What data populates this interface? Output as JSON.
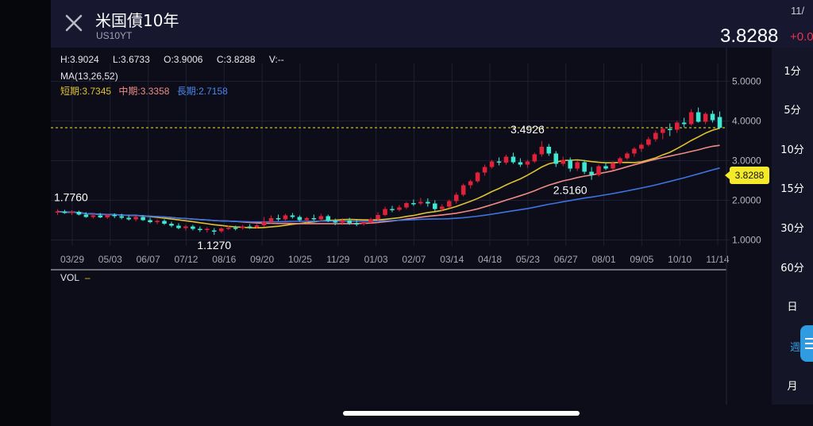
{
  "header": {
    "title": "米国債10年",
    "symbol": "US10YT",
    "date_clipped": "11/",
    "price": "3.8288",
    "change_clipped": "+0.0"
  },
  "ohlc": {
    "high": "H:3.9024",
    "low": "L:3.6733",
    "open": "O:3.9006",
    "close": "C:3.8288",
    "volume": "V:--"
  },
  "ma": {
    "title": "MA(13,26,52)",
    "short": "短期:3.7345",
    "mid": "中期:3.3358",
    "long": "長期:2.7158"
  },
  "volume_label": "VOL",
  "current_price_tag": "3.8288",
  "colors": {
    "up": "#e0213a",
    "down": "#3ee8d2",
    "ma_short": "#e0c230",
    "ma_mid": "#f08a86",
    "ma_long": "#3d74e0",
    "price_line": "#f5ea2a"
  },
  "timeframes": [
    "1分",
    "5分",
    "10分",
    "15分",
    "30分",
    "60分",
    "日",
    "週",
    "月"
  ],
  "active_timeframe": "週",
  "chart_data": {
    "type": "candlestick",
    "x_ticks": [
      "03/29",
      "05/03",
      "06/07",
      "07/12",
      "08/16",
      "09/20",
      "10/25",
      "11/29",
      "01/03",
      "02/07",
      "03/14",
      "04/18",
      "05/23",
      "06/27",
      "08/01",
      "09/05",
      "10/10",
      "11/14"
    ],
    "y_ticks": [
      "5.0000",
      "4.0000",
      "3.0000",
      "2.0000",
      "1.0000"
    ],
    "ylim": [
      0.85,
      5.25
    ],
    "last_close": 3.8288,
    "annotations": [
      {
        "label": "1.7760",
        "value": 1.776,
        "index": 0
      },
      {
        "label": "1.1270",
        "value": 1.127,
        "index": 22
      },
      {
        "label": "3.4926",
        "value": 3.4926,
        "index": 66
      },
      {
        "label": "2.5160",
        "value": 2.516,
        "index": 72
      }
    ],
    "candles": [
      {
        "o": 1.69,
        "h": 1.776,
        "l": 1.63,
        "c": 1.72
      },
      {
        "o": 1.72,
        "h": 1.76,
        "l": 1.66,
        "c": 1.68
      },
      {
        "o": 1.68,
        "h": 1.75,
        "l": 1.63,
        "c": 1.71
      },
      {
        "o": 1.71,
        "h": 1.74,
        "l": 1.62,
        "c": 1.64
      },
      {
        "o": 1.64,
        "h": 1.7,
        "l": 1.56,
        "c": 1.58
      },
      {
        "o": 1.58,
        "h": 1.66,
        "l": 1.54,
        "c": 1.62
      },
      {
        "o": 1.62,
        "h": 1.68,
        "l": 1.55,
        "c": 1.57
      },
      {
        "o": 1.57,
        "h": 1.66,
        "l": 1.53,
        "c": 1.63
      },
      {
        "o": 1.63,
        "h": 1.67,
        "l": 1.55,
        "c": 1.6
      },
      {
        "o": 1.6,
        "h": 1.66,
        "l": 1.52,
        "c": 1.56
      },
      {
        "o": 1.56,
        "h": 1.62,
        "l": 1.49,
        "c": 1.52
      },
      {
        "o": 1.52,
        "h": 1.6,
        "l": 1.47,
        "c": 1.58
      },
      {
        "o": 1.58,
        "h": 1.62,
        "l": 1.48,
        "c": 1.5
      },
      {
        "o": 1.5,
        "h": 1.56,
        "l": 1.42,
        "c": 1.45
      },
      {
        "o": 1.45,
        "h": 1.52,
        "l": 1.4,
        "c": 1.48
      },
      {
        "o": 1.48,
        "h": 1.52,
        "l": 1.38,
        "c": 1.41
      },
      {
        "o": 1.41,
        "h": 1.46,
        "l": 1.32,
        "c": 1.36
      },
      {
        "o": 1.36,
        "h": 1.42,
        "l": 1.27,
        "c": 1.3
      },
      {
        "o": 1.3,
        "h": 1.38,
        "l": 1.24,
        "c": 1.34
      },
      {
        "o": 1.34,
        "h": 1.38,
        "l": 1.24,
        "c": 1.28
      },
      {
        "o": 1.28,
        "h": 1.34,
        "l": 1.2,
        "c": 1.26
      },
      {
        "o": 1.26,
        "h": 1.32,
        "l": 1.19,
        "c": 1.28
      },
      {
        "o": 1.24,
        "h": 1.3,
        "l": 1.127,
        "c": 1.22
      },
      {
        "o": 1.22,
        "h": 1.32,
        "l": 1.18,
        "c": 1.29
      },
      {
        "o": 1.29,
        "h": 1.36,
        "l": 1.25,
        "c": 1.31
      },
      {
        "o": 1.31,
        "h": 1.36,
        "l": 1.24,
        "c": 1.3
      },
      {
        "o": 1.3,
        "h": 1.38,
        "l": 1.26,
        "c": 1.34
      },
      {
        "o": 1.34,
        "h": 1.4,
        "l": 1.28,
        "c": 1.32
      },
      {
        "o": 1.32,
        "h": 1.4,
        "l": 1.29,
        "c": 1.37
      },
      {
        "o": 1.37,
        "h": 1.58,
        "l": 1.33,
        "c": 1.46
      },
      {
        "o": 1.46,
        "h": 1.62,
        "l": 1.42,
        "c": 1.55
      },
      {
        "o": 1.55,
        "h": 1.64,
        "l": 1.48,
        "c": 1.52
      },
      {
        "o": 1.52,
        "h": 1.66,
        "l": 1.49,
        "c": 1.62
      },
      {
        "o": 1.62,
        "h": 1.68,
        "l": 1.54,
        "c": 1.58
      },
      {
        "o": 1.58,
        "h": 1.62,
        "l": 1.46,
        "c": 1.5
      },
      {
        "o": 1.5,
        "h": 1.58,
        "l": 1.44,
        "c": 1.55
      },
      {
        "o": 1.55,
        "h": 1.64,
        "l": 1.49,
        "c": 1.52
      },
      {
        "o": 1.52,
        "h": 1.66,
        "l": 1.47,
        "c": 1.6
      },
      {
        "o": 1.6,
        "h": 1.64,
        "l": 1.45,
        "c": 1.48
      },
      {
        "o": 1.48,
        "h": 1.54,
        "l": 1.37,
        "c": 1.44
      },
      {
        "o": 1.44,
        "h": 1.55,
        "l": 1.38,
        "c": 1.49
      },
      {
        "o": 1.49,
        "h": 1.56,
        "l": 1.38,
        "c": 1.42
      },
      {
        "o": 1.42,
        "h": 1.5,
        "l": 1.35,
        "c": 1.4
      },
      {
        "o": 1.4,
        "h": 1.48,
        "l": 1.36,
        "c": 1.45
      },
      {
        "o": 1.45,
        "h": 1.56,
        "l": 1.4,
        "c": 1.52
      },
      {
        "o": 1.52,
        "h": 1.7,
        "l": 1.48,
        "c": 1.63
      },
      {
        "o": 1.63,
        "h": 1.84,
        "l": 1.6,
        "c": 1.78
      },
      {
        "o": 1.78,
        "h": 1.86,
        "l": 1.7,
        "c": 1.76
      },
      {
        "o": 1.76,
        "h": 1.88,
        "l": 1.72,
        "c": 1.82
      },
      {
        "o": 1.82,
        "h": 1.96,
        "l": 1.78,
        "c": 1.93
      },
      {
        "o": 1.93,
        "h": 2.02,
        "l": 1.86,
        "c": 1.92
      },
      {
        "o": 1.92,
        "h": 2.06,
        "l": 1.88,
        "c": 1.96
      },
      {
        "o": 1.96,
        "h": 2.05,
        "l": 1.84,
        "c": 1.92
      },
      {
        "o": 1.92,
        "h": 2.0,
        "l": 1.72,
        "c": 1.78
      },
      {
        "o": 1.78,
        "h": 1.9,
        "l": 1.72,
        "c": 1.84
      },
      {
        "o": 1.84,
        "h": 2.02,
        "l": 1.8,
        "c": 1.98
      },
      {
        "o": 1.98,
        "h": 2.2,
        "l": 1.92,
        "c": 2.14
      },
      {
        "o": 2.14,
        "h": 2.42,
        "l": 2.1,
        "c": 2.38
      },
      {
        "o": 2.38,
        "h": 2.52,
        "l": 2.3,
        "c": 2.48
      },
      {
        "o": 2.48,
        "h": 2.72,
        "l": 2.44,
        "c": 2.7
      },
      {
        "o": 2.7,
        "h": 2.9,
        "l": 2.62,
        "c": 2.84
      },
      {
        "o": 2.84,
        "h": 3.02,
        "l": 2.8,
        "c": 2.98
      },
      {
        "o": 2.98,
        "h": 3.08,
        "l": 2.88,
        "c": 2.95
      },
      {
        "o": 2.95,
        "h": 3.15,
        "l": 2.9,
        "c": 3.1
      },
      {
        "o": 3.1,
        "h": 3.2,
        "l": 2.92,
        "c": 2.96
      },
      {
        "o": 2.96,
        "h": 3.06,
        "l": 2.84,
        "c": 2.9
      },
      {
        "o": 2.9,
        "h": 3.02,
        "l": 2.82,
        "c": 2.98
      },
      {
        "o": 2.98,
        "h": 3.2,
        "l": 2.94,
        "c": 3.16
      },
      {
        "o": 3.16,
        "h": 3.4926,
        "l": 3.1,
        "c": 3.35
      },
      {
        "o": 3.35,
        "h": 3.42,
        "l": 3.12,
        "c": 3.18
      },
      {
        "o": 3.18,
        "h": 3.24,
        "l": 2.84,
        "c": 2.92
      },
      {
        "o": 2.92,
        "h": 3.1,
        "l": 2.86,
        "c": 3.02
      },
      {
        "o": 3.02,
        "h": 3.08,
        "l": 2.72,
        "c": 2.8
      },
      {
        "o": 2.8,
        "h": 3.0,
        "l": 2.74,
        "c": 2.96
      },
      {
        "o": 2.96,
        "h": 3.02,
        "l": 2.66,
        "c": 2.72
      },
      {
        "o": 2.72,
        "h": 2.84,
        "l": 2.516,
        "c": 2.64
      },
      {
        "o": 2.64,
        "h": 2.9,
        "l": 2.6,
        "c": 2.86
      },
      {
        "o": 2.86,
        "h": 2.96,
        "l": 2.76,
        "c": 2.8
      },
      {
        "o": 2.8,
        "h": 2.98,
        "l": 2.76,
        "c": 2.94
      },
      {
        "o": 2.94,
        "h": 3.1,
        "l": 2.9,
        "c": 3.06
      },
      {
        "o": 3.06,
        "h": 3.22,
        "l": 3.02,
        "c": 3.18
      },
      {
        "o": 3.18,
        "h": 3.34,
        "l": 3.1,
        "c": 3.3
      },
      {
        "o": 3.3,
        "h": 3.44,
        "l": 3.22,
        "c": 3.4
      },
      {
        "o": 3.4,
        "h": 3.6,
        "l": 3.36,
        "c": 3.54
      },
      {
        "o": 3.54,
        "h": 3.76,
        "l": 3.48,
        "c": 3.7
      },
      {
        "o": 3.7,
        "h": 3.84,
        "l": 3.54,
        "c": 3.8
      },
      {
        "o": 3.8,
        "h": 3.94,
        "l": 3.62,
        "c": 3.78
      },
      {
        "o": 3.78,
        "h": 4.0,
        "l": 3.7,
        "c": 3.96
      },
      {
        "o": 3.96,
        "h": 4.08,
        "l": 3.84,
        "c": 3.92
      },
      {
        "o": 3.92,
        "h": 4.3,
        "l": 3.88,
        "c": 4.22
      },
      {
        "o": 4.22,
        "h": 4.34,
        "l": 3.96,
        "c": 3.98
      },
      {
        "o": 3.98,
        "h": 4.22,
        "l": 3.92,
        "c": 4.18
      },
      {
        "o": 4.18,
        "h": 4.26,
        "l": 3.96,
        "c": 4.02
      },
      {
        "o": 4.1,
        "h": 4.24,
        "l": 3.8,
        "c": 3.8288
      }
    ]
  }
}
